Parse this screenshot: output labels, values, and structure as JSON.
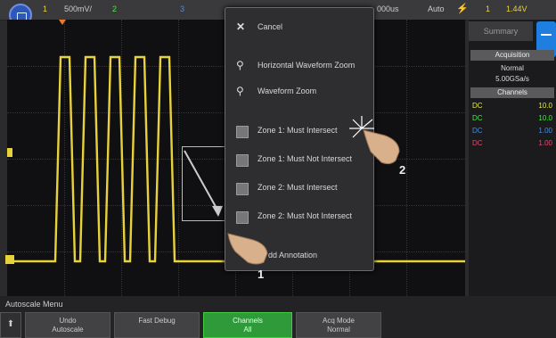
{
  "top_bar": {
    "ch1_num": "1",
    "ch1_scale": "500mV/",
    "ch2_num": "2",
    "ch3_num": "3",
    "timebase": "000us",
    "trigger_mode": "Auto",
    "trig_ch": "1",
    "trig_level": "1.44V"
  },
  "menu": {
    "cancel": "Cancel",
    "horizontal_zoom": "Horizontal Waveform Zoom",
    "waveform_zoom": "Waveform Zoom",
    "zone1_must": "Zone 1: Must Intersect",
    "zone1_not": "Zone 1: Must Not Intersect",
    "zone2_must": "Zone 2: Must Intersect",
    "zone2_not": "Zone 2: Must Not Intersect",
    "add_annotation": "dd Annotation"
  },
  "callouts": {
    "one": "1",
    "two": "2"
  },
  "right_panel": {
    "summary_tab": "Summary",
    "acq_header": "Acquisition",
    "acq_mode": "Normal",
    "acq_rate": "5.00GSa/s",
    "channels_header": "Channels",
    "channels": [
      {
        "coupling": "DC",
        "value": "10.0",
        "color": "#e8e84a"
      },
      {
        "coupling": "DC",
        "value": "10.0",
        "color": "#4ae84a"
      },
      {
        "coupling": "DC",
        "value": "1.00",
        "color": "#4a8ae8"
      },
      {
        "coupling": "DC",
        "value": "1.00",
        "color": "#e84a6a"
      }
    ]
  },
  "bottom": {
    "title": "Autoscale Menu",
    "keys": [
      {
        "line1": "Undo",
        "line2": "Autoscale"
      },
      {
        "line1": "Fast Debug",
        "line2": ""
      },
      {
        "line1": "Channels",
        "line2": "All"
      },
      {
        "line1": "Acq Mode",
        "line2": "Normal"
      }
    ]
  },
  "colors": {
    "ch1": "#e8d23a",
    "accent": "#1f7fe0",
    "active_softkey": "#2e9a3a"
  }
}
